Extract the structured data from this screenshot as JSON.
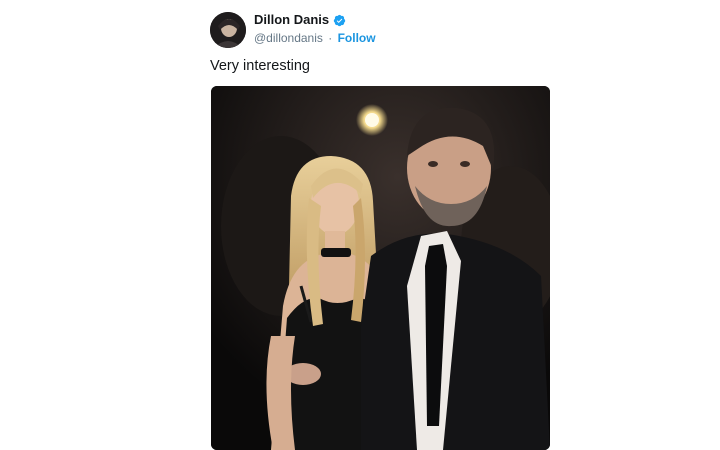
{
  "tweet": {
    "author": {
      "display_name": "Dillon Danis",
      "handle": "@dillondanis",
      "separator": "·",
      "follow_label": "Follow",
      "verified": true,
      "verified_icon": "verified-badge-icon",
      "accent_color": "#1b95e0"
    },
    "text": "Very interesting",
    "media": {
      "kind": "photo",
      "icon": "photo-icon"
    }
  }
}
